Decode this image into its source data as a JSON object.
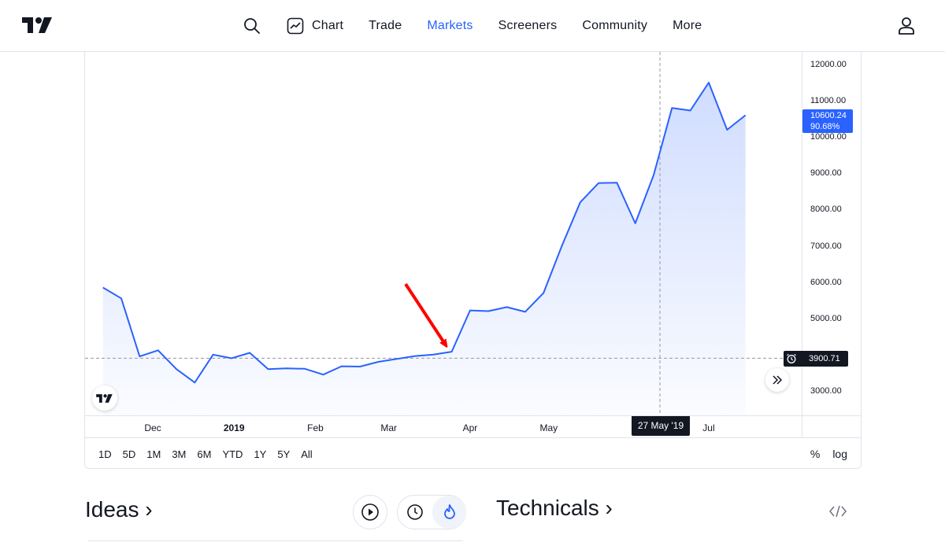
{
  "header": {
    "nav": [
      {
        "label": "Chart",
        "active": false
      },
      {
        "label": "Trade",
        "active": false
      },
      {
        "label": "Markets",
        "active": true
      },
      {
        "label": "Screeners",
        "active": false
      },
      {
        "label": "Community",
        "active": false
      },
      {
        "label": "More",
        "active": false
      }
    ],
    "icons": [
      "tradingview-logo-icon",
      "search-icon",
      "chart-icon",
      "user-icon"
    ]
  },
  "chart": {
    "price_ticks": [
      "12000.00",
      "11000.00",
      "10000.00",
      "9000.00",
      "8000.00",
      "7000.00",
      "6000.00",
      "5000.00",
      "3000.00"
    ],
    "last_price": "10600.24",
    "last_change": "90.68%",
    "baseline_price": "3900.71",
    "time_ticks": [
      {
        "label": "Dec",
        "bold": false
      },
      {
        "label": "2019",
        "bold": true
      },
      {
        "label": "Feb",
        "bold": false
      },
      {
        "label": "Mar",
        "bold": false
      },
      {
        "label": "Apr",
        "bold": false
      },
      {
        "label": "May",
        "bold": false
      },
      {
        "label": "Jul",
        "bold": false
      }
    ],
    "crosshair_date": "27 May '19",
    "line_color": "#2962ff",
    "arrow_color": "#ff0000"
  },
  "chart_data": {
    "type": "area",
    "x": [
      "2018-11-12",
      "2018-11-19",
      "2018-11-26",
      "2018-12-03",
      "2018-12-10",
      "2018-12-17",
      "2018-12-24",
      "2018-12-31",
      "2019-01-07",
      "2019-01-14",
      "2019-01-21",
      "2019-01-28",
      "2019-02-04",
      "2019-02-11",
      "2019-02-18",
      "2019-02-25",
      "2019-03-04",
      "2019-03-11",
      "2019-03-18",
      "2019-03-25",
      "2019-04-01",
      "2019-04-08",
      "2019-04-15",
      "2019-04-22",
      "2019-04-29",
      "2019-05-06",
      "2019-05-13",
      "2019-05-20",
      "2019-05-27",
      "2019-06-03",
      "2019-06-10",
      "2019-06-17",
      "2019-06-24",
      "2019-07-01",
      "2019-07-08",
      "2019-07-15"
    ],
    "values": [
      5850,
      5550,
      3950,
      4120,
      3600,
      3230,
      4000,
      3900,
      4050,
      3600,
      3620,
      3610,
      3450,
      3680,
      3670,
      3800,
      3880,
      3960,
      4000,
      4080,
      5220,
      5200,
      5310,
      5180,
      5700,
      7000,
      8200,
      8730,
      8740,
      7620,
      8950,
      10800,
      10730,
      11500,
      10200,
      10600
    ],
    "baseline": 3900.71,
    "ylim": [
      2000,
      12300
    ],
    "ylabel": "",
    "xlabel": "",
    "title": "",
    "grid": false,
    "annotations": [
      {
        "type": "arrow",
        "points_to_x": "2019-03-25"
      }
    ]
  },
  "ranges": [
    "1D",
    "5D",
    "1M",
    "3M",
    "6M",
    "YTD",
    "1Y",
    "5Y",
    "All"
  ],
  "scale": {
    "percent": "%",
    "log": "log"
  },
  "sections": {
    "ideas": "Ideas ›",
    "technicals": "Technicals ›"
  }
}
